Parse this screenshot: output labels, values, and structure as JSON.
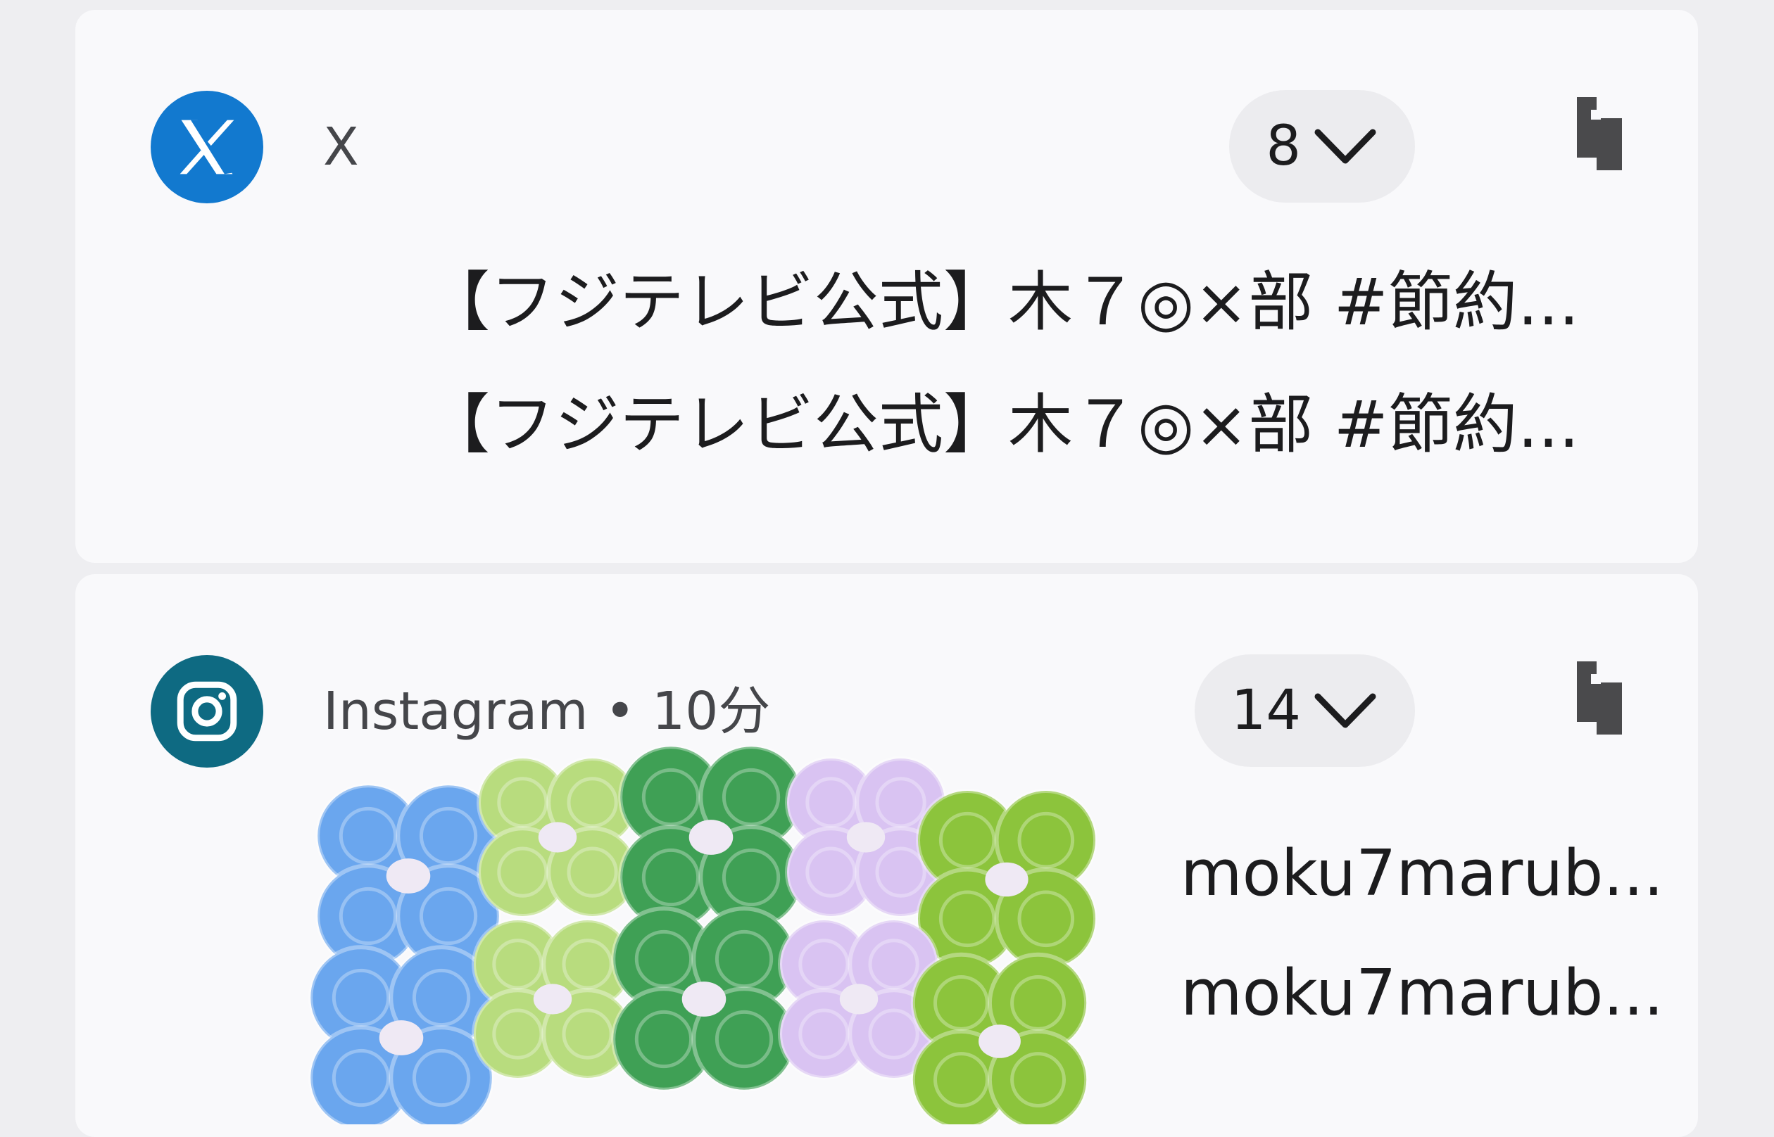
{
  "notifications": [
    {
      "app": "X",
      "count": "8",
      "lines": [
        "【フジテレビ公式】木７◎×部 #節約...",
        "【フジテレビ公式】木７◎×部 #節約..."
      ],
      "icon": "x-logo-icon",
      "icon_color": "#1279cf"
    },
    {
      "app": "Instagram • 10分",
      "count": "14",
      "lines": [
        "moku7marub...",
        "moku7marub..."
      ],
      "icon": "instagram-logo-icon",
      "icon_color": "#0e6a82"
    }
  ],
  "decoration": {
    "icon": "flower-sticker-icon",
    "colors": [
      "#6aa6ee",
      "#b8dc7e",
      "#3fa055",
      "#d9c3f2",
      "#8cc43c"
    ]
  }
}
